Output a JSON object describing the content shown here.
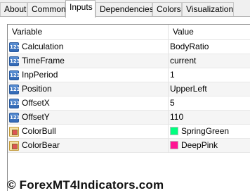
{
  "tabs": [
    {
      "label": "About"
    },
    {
      "label": "Common"
    },
    {
      "label": "Inputs"
    },
    {
      "label": "Dependencies"
    },
    {
      "label": "Colors"
    },
    {
      "label": "Visualization"
    }
  ],
  "active_tab": "Inputs",
  "grid": {
    "header": {
      "variable": "Variable",
      "value": "Value"
    },
    "rows": [
      {
        "name": "Calculation",
        "value": "BodyRatio",
        "icon": "number-type-icon"
      },
      {
        "name": "TimeFrame",
        "value": "current",
        "icon": "number-type-icon"
      },
      {
        "name": "InpPeriod",
        "value": "1",
        "icon": "number-type-icon"
      },
      {
        "name": "Position",
        "value": "UpperLeft",
        "icon": "number-type-icon"
      },
      {
        "name": "OffsetX",
        "value": "5",
        "icon": "number-type-icon"
      },
      {
        "name": "OffsetY",
        "value": "110",
        "icon": "number-type-icon"
      },
      {
        "name": "ColorBull",
        "value": "SpringGreen",
        "icon": "color-type-icon",
        "swatch": "#00ff7f"
      },
      {
        "name": "ColorBear",
        "value": "DeepPink",
        "icon": "color-type-icon",
        "swatch": "#ff1493"
      }
    ]
  },
  "watermark": "© ForexMT4Indicators.com"
}
